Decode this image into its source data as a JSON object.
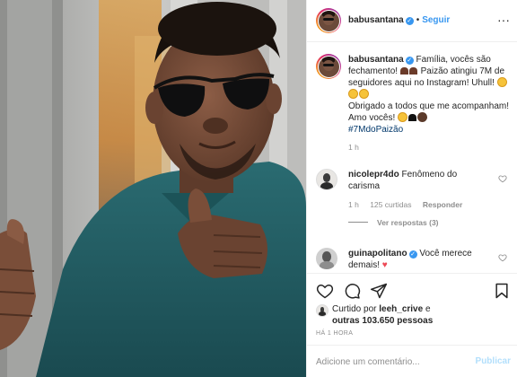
{
  "post": {
    "username": "babusantana",
    "follow_label": "Seguir",
    "more_label": "···"
  },
  "caption": {
    "username": "babusantana",
    "line1": "Família, vocês são fechamento!",
    "line2": "Paizão atingiu 7M de seguidores aqui no Instagram! Uhull",
    "line3": "Obrigado a todos que me acompanham! Amo vocês!",
    "hashtag": "#7MdoPaizão",
    "time": "1 h"
  },
  "comments": [
    {
      "username": "nicolepr4do",
      "text": "Fenômeno do carisma",
      "time": "1 h",
      "likes": "125 curtidas",
      "reply_label": "Responder",
      "view_replies": "Ver respostas (3)"
    },
    {
      "username": "guinapolitano",
      "text": "Você merece demais!",
      "heart": "♥"
    }
  ],
  "likes": {
    "prefix": "Curtido por",
    "user": "leeh_crive",
    "conj": "e",
    "others": "outras 103.650 pessoas"
  },
  "timestamp": "HÁ 1 HORA",
  "composer": {
    "placeholder": "Adicione um comentário...",
    "publish_label": "Publicar"
  },
  "icons": {
    "like": "heart-icon",
    "comment": "comment-icon",
    "share": "share-icon",
    "save": "bookmark-icon"
  },
  "colors": {
    "link_blue": "#3897f0",
    "hashtag": "#00376b",
    "muted": "#8e8e8e",
    "heart_red": "#ed4956",
    "publish_disabled": "#b2dffc"
  }
}
